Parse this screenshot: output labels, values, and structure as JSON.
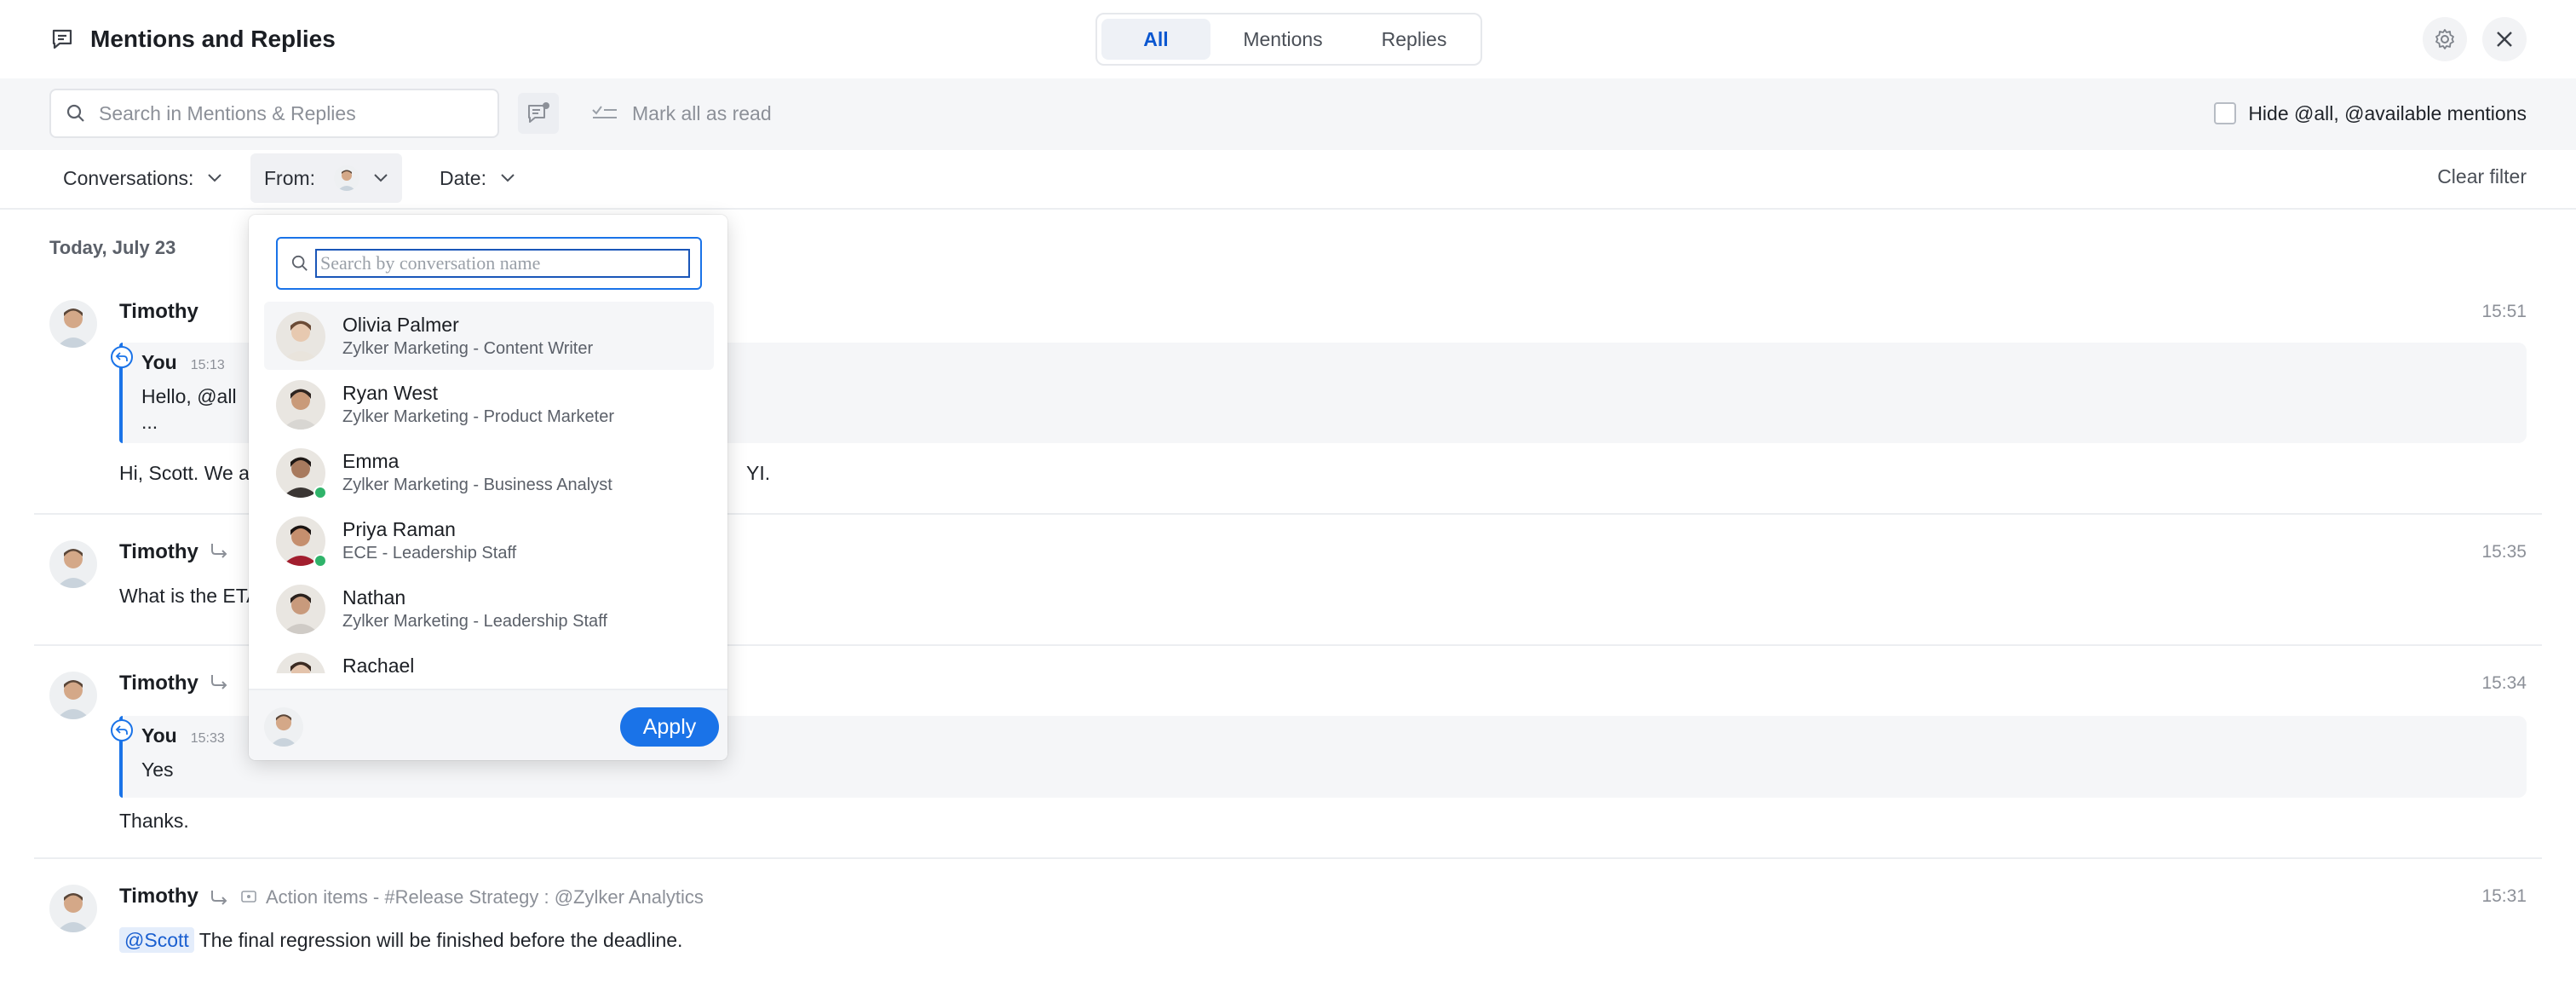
{
  "header": {
    "title": "Mentions and Replies",
    "tabs": [
      {
        "label": "All",
        "active": true
      },
      {
        "label": "Mentions",
        "active": false
      },
      {
        "label": "Replies",
        "active": false
      }
    ]
  },
  "toolbar": {
    "search_placeholder": "Search in Mentions & Replies",
    "mark_all_read": "Mark all as read",
    "hide_mentions": "Hide @all, @available mentions"
  },
  "filters": {
    "conversations": "Conversations:",
    "from": "From:",
    "date": "Date:",
    "clear": "Clear filter"
  },
  "feed": {
    "date_heading": "Today, July 23",
    "messages": [
      {
        "sender": "Timothy",
        "time": "15:51",
        "quote": {
          "sender": "You",
          "time": "15:13",
          "line1": "Hello, @all",
          "line2": "..."
        },
        "body_start": "Hi, Scott. We are",
        "body_end": "YI."
      },
      {
        "sender": "Timothy",
        "time": "15:35",
        "body": "What is the ETA"
      },
      {
        "sender": "Timothy",
        "time": "15:34",
        "quote": {
          "sender": "You",
          "time": "15:33",
          "line1": "Yes"
        },
        "body": "Thanks."
      },
      {
        "sender": "Timothy",
        "time": "15:31",
        "crumb": "Action items - #Release Strategy : @Zylker Analytics",
        "mention": "@Scott",
        "body": " The final regression will be finished before the deadline."
      }
    ]
  },
  "dropdown": {
    "search_placeholder": "Search by conversation name",
    "people": [
      {
        "name": "Olivia Palmer",
        "desc": "Zylker Marketing - Content Writer",
        "online": false,
        "skin": "#e7c9b0",
        "hair": "#6b4b36",
        "shirt": "#e9e4dc"
      },
      {
        "name": "Ryan West",
        "desc": "Zylker Marketing - Product Marketer",
        "online": false,
        "skin": "#c99a79",
        "hair": "#2e2420",
        "shirt": "#d8d6d2"
      },
      {
        "name": "Emma",
        "desc": "Zylker Marketing - Business Analyst",
        "online": true,
        "skin": "#a87a5e",
        "hair": "#1e1815",
        "shirt": "#3a3533"
      },
      {
        "name": "Priya Raman",
        "desc": "ECE - Leadership Staff",
        "online": true,
        "skin": "#c58f6e",
        "hair": "#1a1412",
        "shirt": "#a21e2e"
      },
      {
        "name": "Nathan",
        "desc": "Zylker Marketing - Leadership Staff",
        "online": false,
        "skin": "#c89a7c",
        "hair": "#2a211d",
        "shirt": "#cfcbc6"
      },
      {
        "name": "Rachael",
        "desc": "",
        "online": false,
        "skin": "#e3c3ab",
        "hair": "#3b2b22",
        "shirt": "#d8d4cf"
      }
    ],
    "apply": "Apply"
  },
  "colors": {
    "accent": "#1a73e8",
    "online": "#2fb36a",
    "muted": "#8c9098"
  }
}
